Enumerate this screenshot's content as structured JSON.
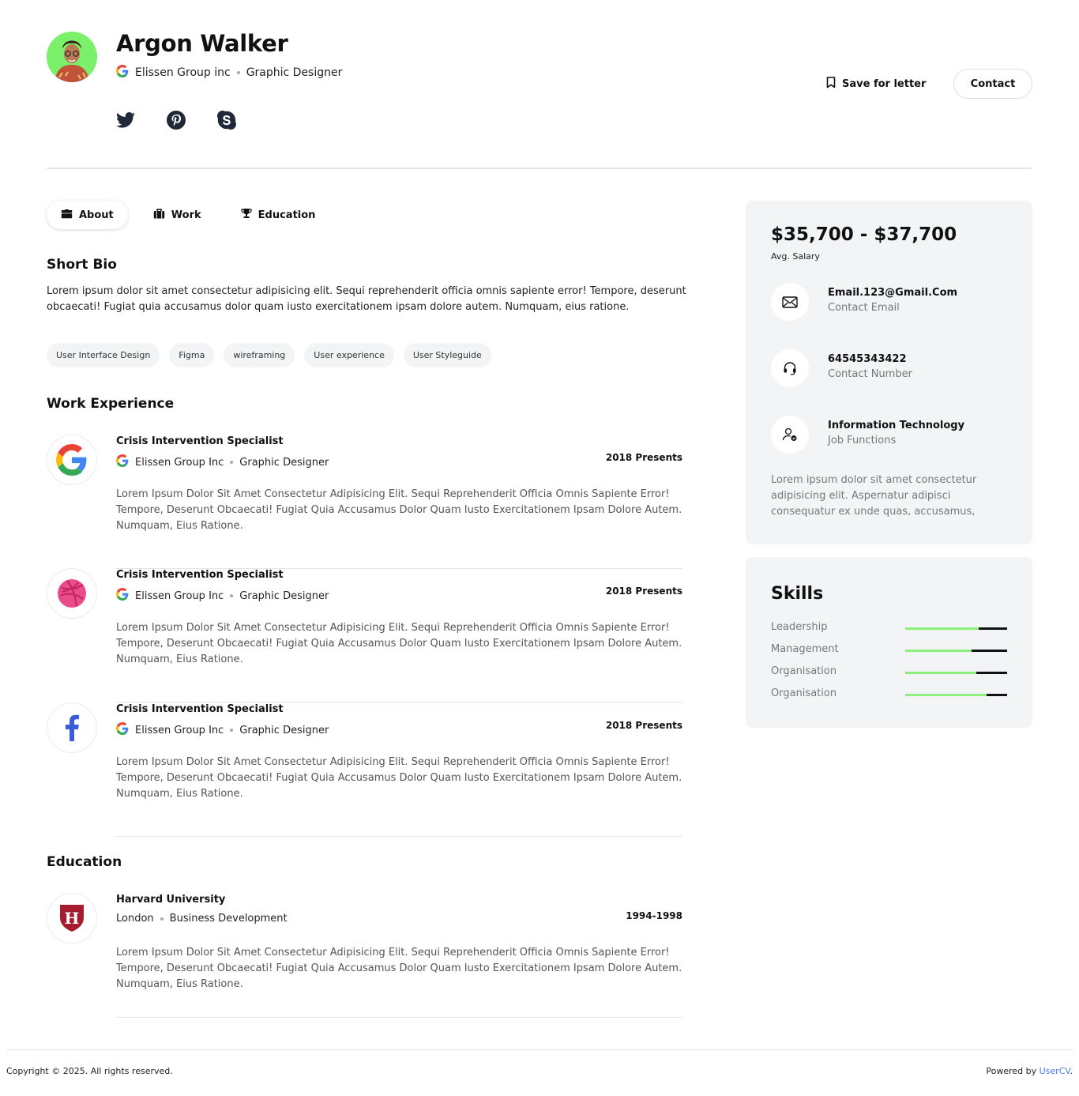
{
  "profile": {
    "name": "Argon Walker",
    "company": "Elissen Group inc",
    "title": "Graphic Designer"
  },
  "header_actions": {
    "save_label": "Save for letter",
    "contact_label": "Contact"
  },
  "tabs": [
    {
      "label": "About",
      "icon": "briefcase-icon"
    },
    {
      "label": "Work",
      "icon": "suitcase-icon"
    },
    {
      "label": "Education",
      "icon": "trophy-icon"
    }
  ],
  "bio": {
    "title": "Short Bio",
    "text": "Lorem ipsum dolor sit amet consectetur adipisicing elit. Sequi reprehenderit officia omnis sapiente error! Tempore, deserunt obcaecati! Fugiat quia accusamus dolor quam iusto exercitationem ipsam dolore autem. Numquam, eius ratione.",
    "tags": [
      "User Interface Design",
      "Figma",
      "wireframing",
      "User experience",
      "User Styleguide"
    ]
  },
  "work": {
    "title": "Work Experience",
    "items": [
      {
        "role": "Crisis Intervention Specialist",
        "company": "Elissen Group Inc",
        "position": "Graphic Designer",
        "period": "2018 Presents",
        "logo": "google-logo-icon",
        "description": "Lorem Ipsum Dolor Sit Amet Consectetur Adipisicing Elit. Sequi Reprehenderit Officia Omnis Sapiente Error! Tempore, Deserunt Obcaecati! Fugiat Quia Accusamus Dolor Quam Iusto Exercitationem Ipsam Dolore Autem. Numquam, Eius Ratione."
      },
      {
        "role": "Crisis Intervention Specialist",
        "company": "Elissen Group Inc",
        "position": "Graphic Designer",
        "period": "2018 Presents",
        "logo": "dribbble-logo-icon",
        "description": "Lorem Ipsum Dolor Sit Amet Consectetur Adipisicing Elit. Sequi Reprehenderit Officia Omnis Sapiente Error! Tempore, Deserunt Obcaecati! Fugiat Quia Accusamus Dolor Quam Iusto Exercitationem Ipsam Dolore Autem. Numquam, Eius Ratione."
      },
      {
        "role": "Crisis Intervention Specialist",
        "company": "Elissen Group Inc",
        "position": "Graphic Designer",
        "period": "2018 Presents",
        "logo": "facebook-logo-icon",
        "description": "Lorem Ipsum Dolor Sit Amet Consectetur Adipisicing Elit. Sequi Reprehenderit Officia Omnis Sapiente Error! Tempore, Deserunt Obcaecati! Fugiat Quia Accusamus Dolor Quam Iusto Exercitationem Ipsam Dolore Autem. Numquam, Eius Ratione."
      }
    ]
  },
  "education": {
    "title": "Education",
    "items": [
      {
        "school": "Harvard University",
        "location": "London",
        "field": "Business Development",
        "period": "1994-1998",
        "logo": "harvard-shield-icon",
        "logo_letter": "H",
        "description": "Lorem Ipsum Dolor Sit Amet Consectetur Adipisicing Elit. Sequi Reprehenderit Officia Omnis Sapiente Error! Tempore, Deserunt Obcaecati! Fugiat Quia Accusamus Dolor Quam Iusto Exercitationem Ipsam Dolore Autem. Numquam, Eius Ratione."
      }
    ]
  },
  "sidebar": {
    "salary": "$35,700 - $37,700",
    "salary_label": "Avg. Salary",
    "info": [
      {
        "value": "Email.123@Gmail.Com",
        "label": "Contact Email",
        "icon": "envelope-icon"
      },
      {
        "value": "64545343422",
        "label": "Contact Number",
        "icon": "headset-icon"
      },
      {
        "value": "Information Technology",
        "label": "Job Functions",
        "icon": "user-check-icon"
      }
    ],
    "description": "Lorem ipsum dolor sit amet consectetur adipisicing elit. Aspernatur adipisci consequatur ex unde quas, accusamus,"
  },
  "skills": {
    "title": "Skills",
    "items": [
      {
        "name": "Leadership",
        "level": 0.72
      },
      {
        "name": "Management",
        "level": 0.65
      },
      {
        "name": "Organisation",
        "level": 0.7
      },
      {
        "name": "Organisation",
        "level": 0.8
      }
    ]
  },
  "colors": {
    "accent_green": "#8ef07c",
    "card_bg": "#f3f4f6",
    "link_blue": "#4a7ce8"
  },
  "footer": {
    "copyright": "Copyright © 2025. All rights reserved.",
    "powered_prefix": "Powered by ",
    "powered_link": "UserCV",
    "powered_suffix": "."
  }
}
